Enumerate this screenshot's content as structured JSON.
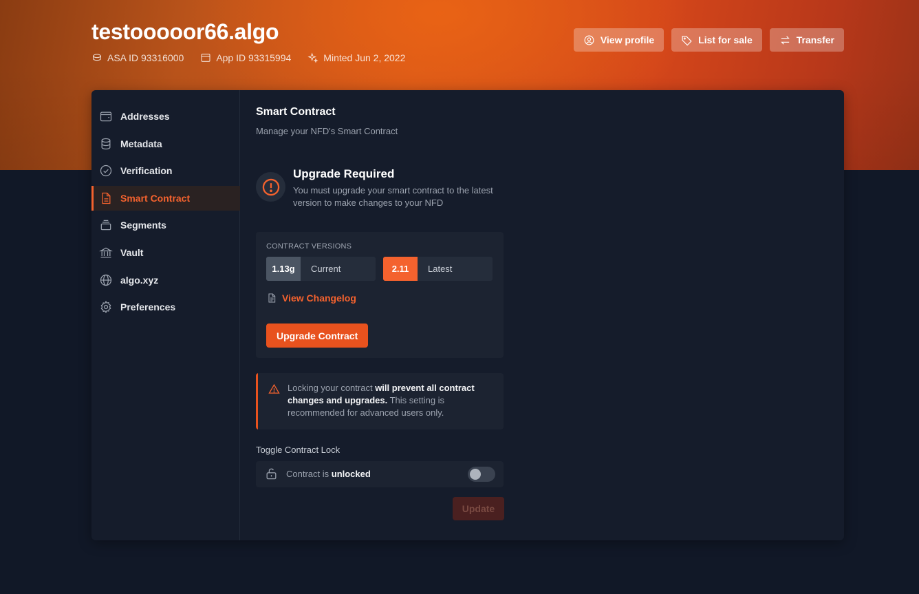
{
  "header": {
    "title": "testooooor66.algo",
    "asa_id": "ASA ID 93316000",
    "app_id": "App ID 93315994",
    "minted": "Minted Jun 2, 2022",
    "actions": {
      "view_profile": "View profile",
      "list_for_sale": "List for sale",
      "transfer": "Transfer"
    }
  },
  "sidebar": {
    "items": [
      {
        "label": "Addresses",
        "icon": "wallet-icon"
      },
      {
        "label": "Metadata",
        "icon": "database-icon"
      },
      {
        "label": "Verification",
        "icon": "check-circle-icon"
      },
      {
        "label": "Smart Contract",
        "icon": "document-icon",
        "active": true
      },
      {
        "label": "Segments",
        "icon": "stack-icon"
      },
      {
        "label": "Vault",
        "icon": "bank-icon"
      },
      {
        "label": "algo.xyz",
        "icon": "globe-icon"
      },
      {
        "label": "Preferences",
        "icon": "gear-icon"
      }
    ]
  },
  "main": {
    "title": "Smart Contract",
    "subtitle": "Manage your NFD's Smart Contract",
    "upgrade": {
      "title": "Upgrade Required",
      "text": "You must upgrade your smart contract to the latest version to make changes to your NFD"
    },
    "versions": {
      "label": "Contract Versions",
      "current_version": "1.13g",
      "current_label": "Current",
      "latest_version": "2.11",
      "latest_label": "Latest",
      "changelog": "View Changelog",
      "upgrade_button": "Upgrade Contract"
    },
    "warning": {
      "text_1": "Locking your contract ",
      "bold_1": "will prevent all contract changes and upgrades.",
      "text_2": " This setting is recommended for advanced users only."
    },
    "lock": {
      "label": "Toggle Contract Lock",
      "status_prefix": "Contract is ",
      "status_value": "unlocked",
      "toggled": false
    },
    "update_button": "Update"
  },
  "colors": {
    "accent": "#f4622e",
    "background": "#111827",
    "card": "#151c2b"
  }
}
